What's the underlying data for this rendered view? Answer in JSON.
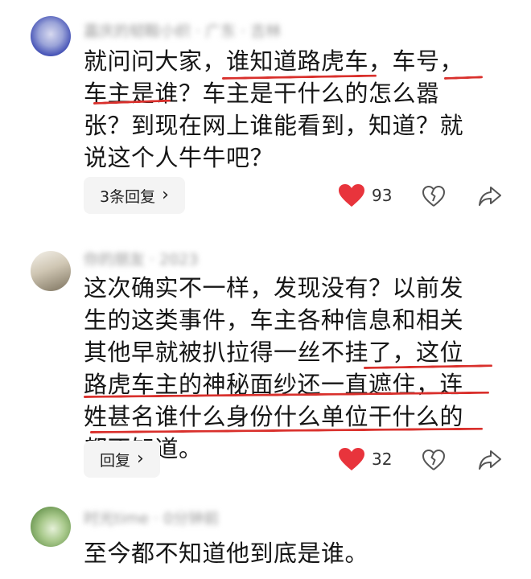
{
  "comments": [
    {
      "username": "嘉庆的韧鞍小织 · 广东 · 吉林",
      "text": "就问问大家，谁知道路虎车，车号，车主是谁？车主是干什么的怎么嚣张？到现在网上谁能看到，知道？就说这个人牛牛吧？",
      "reply_label": "3条回复",
      "likes": "93",
      "like_color": "#e8343c"
    },
    {
      "username": "你的朋友 · 2023",
      "text": "这次确实不一样，发现没有？以前发生的这类事件，车主各种信息和相关其他早就被扒拉得一丝不挂了，这位路虎车主的神秘面纱还一直遮住，连姓甚名谁什么身份什么单位干什么的都不知道。",
      "reply_label": "回复",
      "likes": "32",
      "like_color": "#e8343c"
    },
    {
      "username": "时光time · 0分钟前",
      "text": "至今都不知道他到底是谁。"
    }
  ],
  "icons": {
    "chevron": "›",
    "heart": "heart-icon",
    "dislike": "broken-heart-icon",
    "share": "share-icon"
  },
  "colors": {
    "underline": "#d9302c",
    "reply_bg": "#f4f4f4"
  }
}
